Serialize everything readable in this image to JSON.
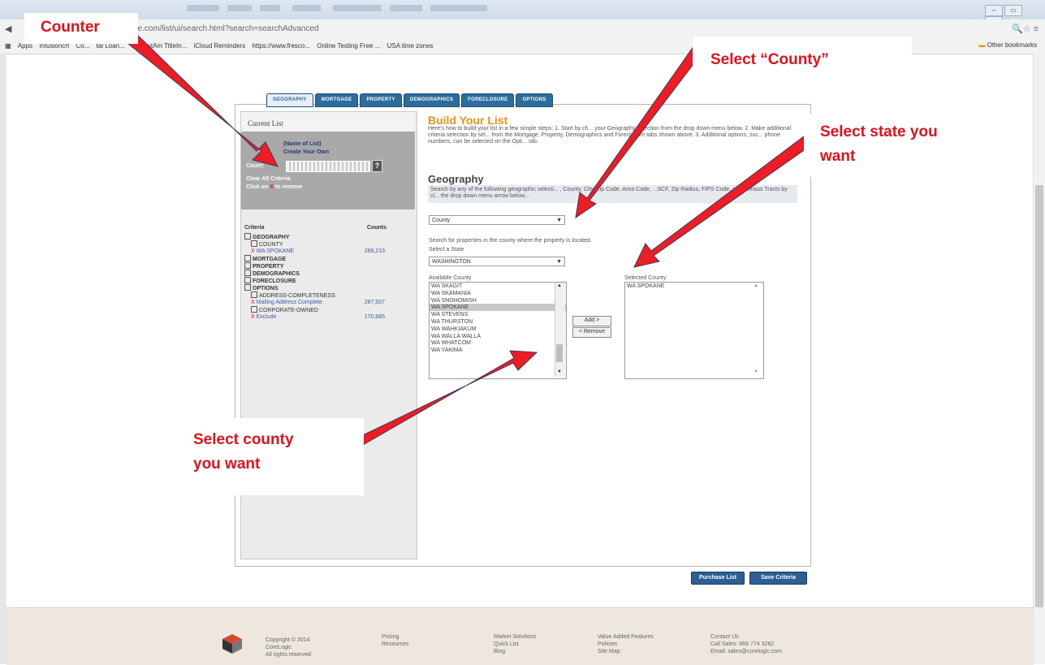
{
  "browser": {
    "url": "ource.com/list/ui/search.html?search=searchAdvanced",
    "bookmarks": [
      "Apps",
      "Infusioncrt",
      "Co...",
      "tal Loan...",
      "myFirstAm TitleIn...",
      "iCloud Reminders",
      "https://www.fresco...",
      "Online Testing Free ...",
      "USA time zones"
    ],
    "other_bookmarks": "Other bookmarks"
  },
  "tabs": [
    "GEOGRAPHY",
    "MORTGAGE",
    "PROPERTY",
    "DEMOGRAPHICS",
    "FORECLOSURE",
    "OPTIONS"
  ],
  "current_list": {
    "title": "Current List",
    "name_of_list": "(Name of List)",
    "create_your_own": "Create Your Own",
    "count_label": "Count:",
    "help": "?",
    "clear_all": "Clear All Criteria",
    "click_on": "Click on",
    "x_mark": "X",
    "to_remove": "to remove"
  },
  "criteria": {
    "header_left": "Criteria",
    "header_right": "Counts",
    "rows": [
      {
        "label": "GEOGRAPHY",
        "style": "bold",
        "box": true,
        "indent": 0
      },
      {
        "label": "COUNTY",
        "style": "normal",
        "box": true,
        "indent": 8
      },
      {
        "label": "WA SPOKANE",
        "style": "blue",
        "count": "289,213",
        "indent": 8,
        "x": true
      },
      {
        "label": "MORTGAGE",
        "style": "bold",
        "box": true,
        "indent": 0
      },
      {
        "label": "PROPERTY",
        "style": "bold",
        "box": true,
        "indent": 0
      },
      {
        "label": "DEMOGRAPHICS",
        "style": "bold",
        "box": true,
        "indent": 0
      },
      {
        "label": "FORECLOSURE",
        "style": "bold",
        "box": true,
        "indent": 0
      },
      {
        "label": "OPTIONS",
        "style": "bold",
        "box": true,
        "indent": 0
      },
      {
        "label": "ADDRESS-COMPLETENESS",
        "style": "normal",
        "box": true,
        "indent": 8
      },
      {
        "label": "Mailing Address Complete",
        "style": "blue",
        "count": "287,507",
        "indent": 8,
        "x": true
      },
      {
        "label": "CORPORATE-OWNED",
        "style": "normal",
        "box": true,
        "indent": 8
      },
      {
        "label": "Exclude",
        "style": "blue",
        "count": "170,885",
        "indent": 8,
        "x": true
      }
    ]
  },
  "build": {
    "title": "Build Your List",
    "text": "Here's how to build your list in a few simple steps: 1. Start by ch... your Geography selection from the drop down menu below. 2. Make additional criteria selection by sel... from the Mortgage, Property, Demographics and Foreclosure tabs shown above. 3. Additional options, suc... phone numbers, can be selected on the Opti... tab."
  },
  "geography": {
    "title": "Geography",
    "description": "Search by any of the following geographic selecti... , County, City, Zip Code, Area Code, ...SCF, Zip Radius, FIPS Code, and Census Tracts by cl... the drop down menu arrow below...",
    "type_select": "County",
    "search_hint": "Search for properties in the county where the property is located.",
    "state_label": "Select a State",
    "state_value": "WASHINGTON",
    "available_label": "Available County",
    "available": [
      "WA SKAGIT",
      "WA SKAMANIA",
      "WA SNOHOMISH",
      "WA SPOKANE",
      "WA STEVENS",
      "WA THURSTON",
      "WA WAHKIAKUM",
      "WA WALLA WALLA",
      "WA WHATCOM",
      "WA YAKIMA"
    ],
    "selected_index": 3,
    "add_btn": "Add >",
    "remove_btn": "< Remove",
    "selected_label": "Selected County",
    "selected": [
      "WA SPOKANE"
    ]
  },
  "actions": {
    "purchase": "Purchase List",
    "save": "Save Criteria"
  },
  "footer": {
    "copyright": "Copyright © 2014 CoreLogic\nAll rights reserved",
    "col1": [
      "Pricing",
      "Resources"
    ],
    "col2": [
      "Market Solutions",
      "Quick List",
      "Blog"
    ],
    "col3": [
      "Value Added Features",
      "Policies",
      "Site Map"
    ],
    "col4": [
      "Contact Us",
      "Call Sales: 866 774 3282",
      "Email: sales@corelogic.com"
    ]
  },
  "annotations": {
    "counter": "Counter",
    "select_county_type": "Select “County”",
    "select_state_1": "Select state you",
    "select_state_2": "want",
    "select_county_1": "Select county",
    "select_county_2": "you want"
  },
  "colors": {
    "annotation_red": "#e3121a",
    "arrow_red": "#ee1c24",
    "tab_blue": "#2c6d9e",
    "title_orange": "#e8901c"
  }
}
